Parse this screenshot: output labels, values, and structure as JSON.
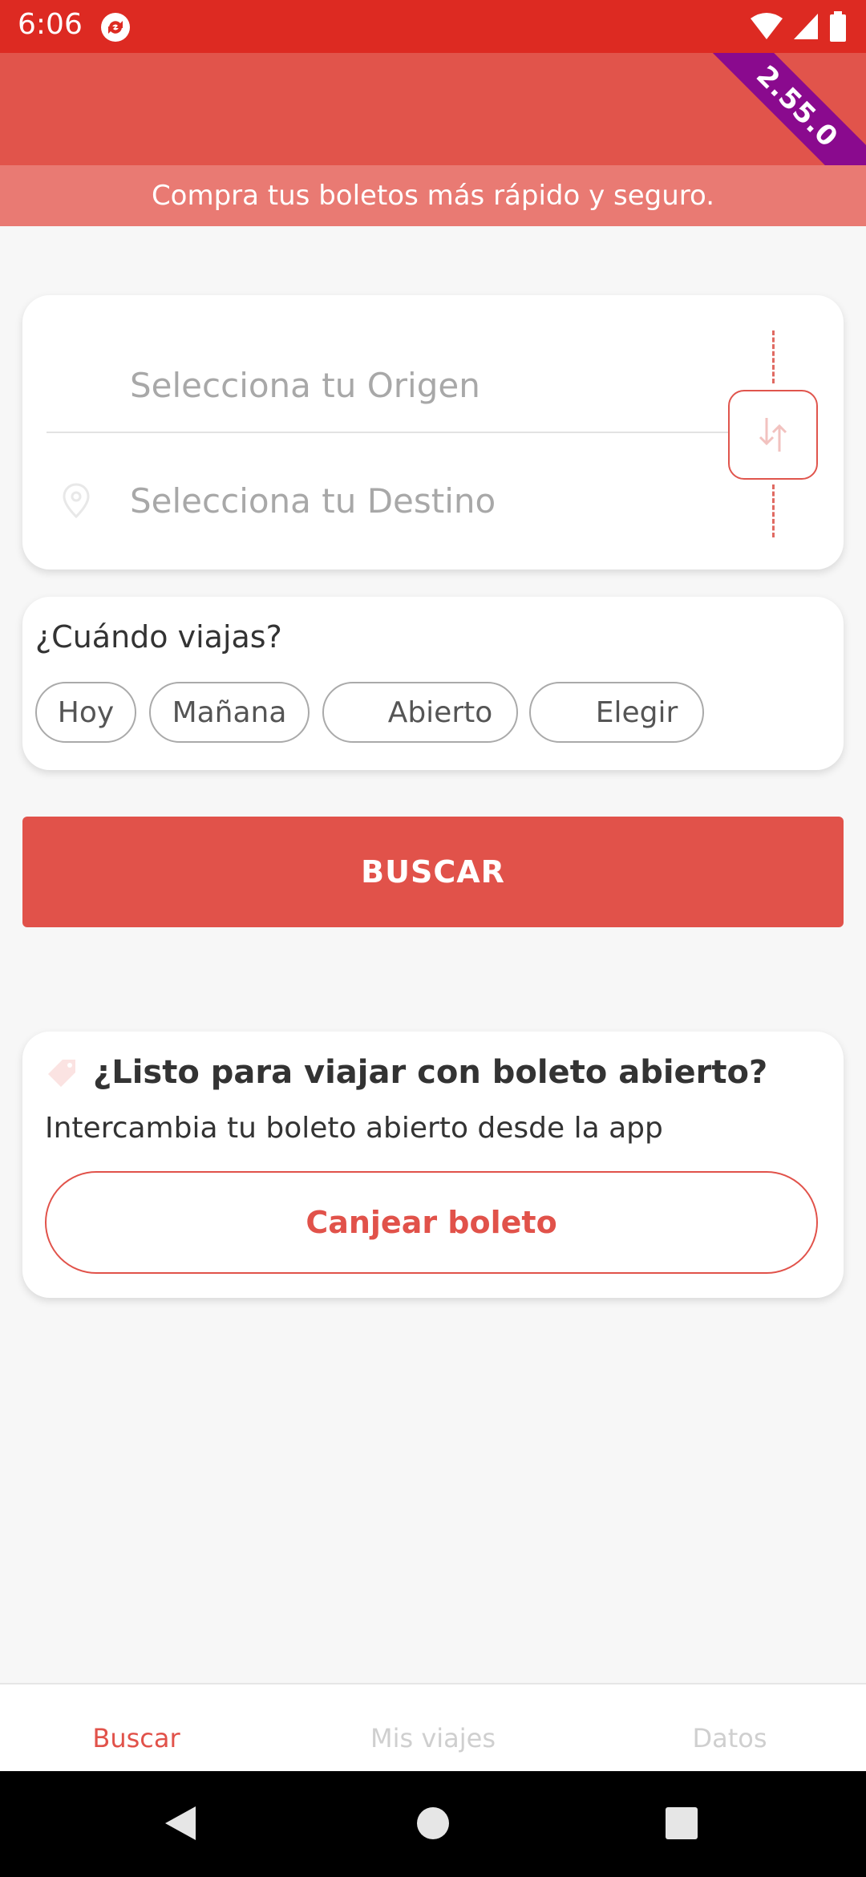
{
  "status_bar": {
    "time": "6:06"
  },
  "app_bar": {
    "version": "2.55.0"
  },
  "tagline": "Compra tus boletos más rápido y seguro.",
  "route": {
    "origin_placeholder": "Selecciona tu Origen",
    "destination_placeholder": "Selecciona tu Destino"
  },
  "when": {
    "title": "¿Cuándo viajas?",
    "chips": [
      "Hoy",
      "Mañana",
      "Abierto",
      "Elegir"
    ]
  },
  "search_button": "BUSCAR",
  "promo": {
    "title": "¿Listo para viajar con boleto abierto?",
    "subtitle": "Intercambia tu boleto abierto desde la app",
    "button": "Canjear boleto"
  },
  "bottom_nav": [
    "Buscar",
    "Mis viajes",
    "Datos"
  ],
  "colors": {
    "primary": "#e1524a",
    "status_bar": "#dd2a22",
    "ribbon": "#8a0a8e"
  }
}
